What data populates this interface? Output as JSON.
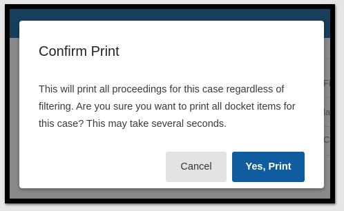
{
  "dialog": {
    "title": "Confirm Print",
    "message": "This will print all proceedings for this case regardless of filtering. Are you sure you want to print all docket items for this case? This may take several seconds.",
    "cancel_label": "Cancel",
    "confirm_label": "Yes, Print"
  },
  "background": {
    "peek_texts": [
      "Fil",
      "la",
      "CE"
    ]
  },
  "colors": {
    "header": "#163f5c",
    "confirm_button": "#0f5c9e",
    "cancel_button": "#e3e3e3",
    "overlay": "#7f7f7f"
  }
}
